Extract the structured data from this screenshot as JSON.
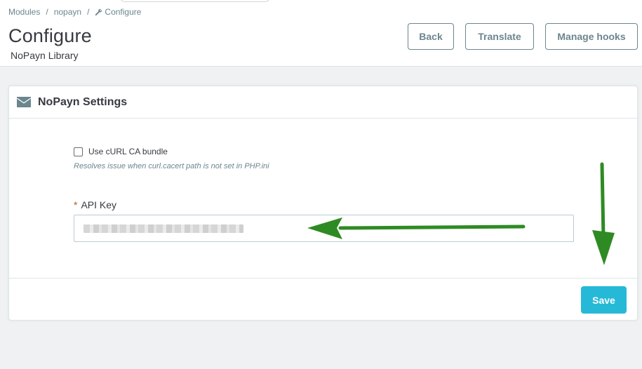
{
  "breadcrumb": {
    "items": [
      "Modules",
      "nopayn",
      "Configure"
    ],
    "separator": "/"
  },
  "header": {
    "title": "Configure",
    "subtitle": "NoPayn Library",
    "buttons": {
      "back": "Back",
      "translate": "Translate",
      "manage_hooks": "Manage hooks"
    }
  },
  "panel": {
    "title": "NoPayn Settings",
    "icon": "envelope-icon",
    "curl_checkbox": {
      "label": "Use cURL CA bundle",
      "checked": false,
      "help": "Resolves issue when curl.cacert path is not set in PHP.ini"
    },
    "api_key": {
      "required_marker": "*",
      "label": "API Key",
      "value_obscured": true
    },
    "save_label": "Save"
  },
  "colors": {
    "accent": "#25b9d7",
    "annotation_arrow": "#2e8b23",
    "required": "#c05c1e",
    "muted_text": "#6c868e"
  }
}
